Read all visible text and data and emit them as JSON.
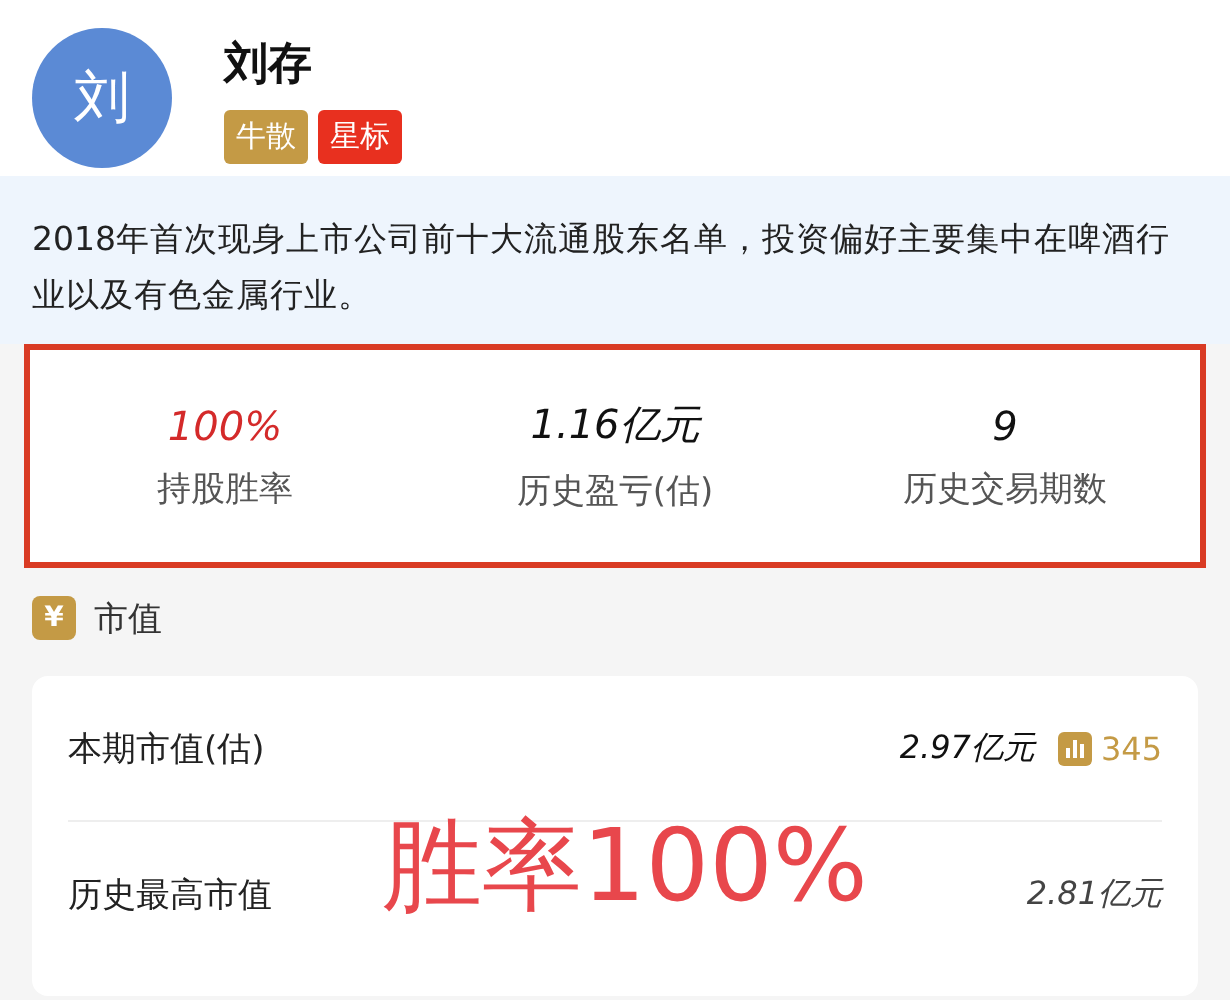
{
  "profile": {
    "avatar": "刘",
    "name": "刘存",
    "tags": [
      {
        "label": "牛散",
        "color": "#c49a45"
      },
      {
        "label": "星标",
        "color": "#e8301f"
      }
    ]
  },
  "description": "2018年首次现身上市公司前十大流通股东名单，投资偏好主要集中在啤酒行业以及有色金属行业。",
  "stats": [
    {
      "value": "100%",
      "label": "持股胜率",
      "color": "#d42a2a"
    },
    {
      "value": "1.16亿元",
      "label": "历史盈亏(估)",
      "color": "#111111"
    },
    {
      "value": "9",
      "label": "历史交易期数",
      "color": "#111111"
    }
  ],
  "section": {
    "icon": "¥",
    "title": "市值"
  },
  "rows": [
    {
      "label": "本期市值(估)",
      "value": "2.97亿元",
      "badge": "345"
    },
    {
      "label": "历史最高市值",
      "value": "2.81亿元"
    }
  ],
  "overlay": "胜率100%"
}
